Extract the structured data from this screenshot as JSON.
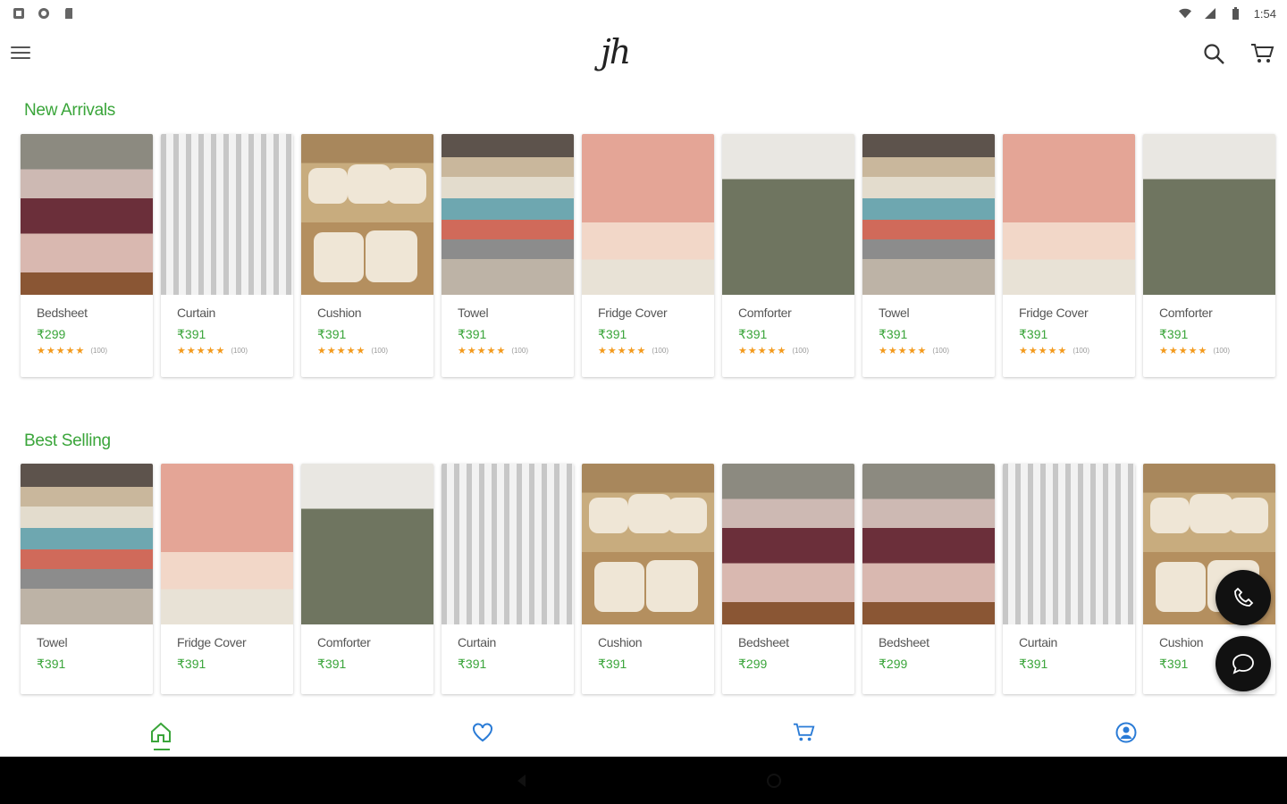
{
  "status_bar": {
    "time": "1:54",
    "left_icons": [
      "notification-icon",
      "sync-icon",
      "sd-card-icon"
    ],
    "right_icons": [
      "wifi-icon",
      "signal-icon",
      "battery-icon"
    ]
  },
  "app_bar": {
    "logo_text": "jh",
    "icons": [
      "menu-icon",
      "search-icon",
      "cart-icon"
    ]
  },
  "colors": {
    "accent": "#3aa53a",
    "price": "#3aa53a",
    "star": "#f39a1d",
    "fab": "#111111"
  },
  "new_arrivals": {
    "title": "New Arrivals",
    "items": [
      {
        "name": "Bedsheet",
        "price": "₹299",
        "stars": "★★★★★",
        "count": "(100)",
        "art": "bedsheet"
      },
      {
        "name": "Curtain",
        "price": "₹391",
        "stars": "★★★★★",
        "count": "(100)",
        "art": "curtain"
      },
      {
        "name": "Cushion",
        "price": "₹391",
        "stars": "★★★★★",
        "count": "(100)",
        "art": "cushion"
      },
      {
        "name": "Towel",
        "price": "₹391",
        "stars": "★★★★★",
        "count": "(100)",
        "art": "towel"
      },
      {
        "name": "Fridge Cover",
        "price": "₹391",
        "stars": "★★★★★",
        "count": "(100)",
        "art": "fridge"
      },
      {
        "name": "Comforter",
        "price": "₹391",
        "stars": "★★★★★",
        "count": "(100)",
        "art": "comforter"
      },
      {
        "name": "Towel",
        "price": "₹391",
        "stars": "★★★★★",
        "count": "(100)",
        "art": "towel"
      },
      {
        "name": "Fridge Cover",
        "price": "₹391",
        "stars": "★★★★★",
        "count": "(100)",
        "art": "fridge"
      },
      {
        "name": "Comforter",
        "price": "₹391",
        "stars": "★★★★★",
        "count": "(100)",
        "art": "comforter"
      }
    ]
  },
  "best_selling": {
    "title": "Best Selling",
    "items": [
      {
        "name": "Towel",
        "price": "₹391",
        "art": "towel"
      },
      {
        "name": "Fridge Cover",
        "price": "₹391",
        "art": "fridge"
      },
      {
        "name": "Comforter",
        "price": "₹391",
        "art": "comforter"
      },
      {
        "name": "Curtain",
        "price": "₹391",
        "art": "curtain"
      },
      {
        "name": "Cushion",
        "price": "₹391",
        "art": "cushion"
      },
      {
        "name": "Bedsheet",
        "price": "₹299",
        "art": "bedsheet"
      },
      {
        "name": "Bedsheet",
        "price": "₹299",
        "art": "bedsheet"
      },
      {
        "name": "Curtain",
        "price": "₹391",
        "art": "curtain"
      },
      {
        "name": "Cushion",
        "price": "₹391",
        "art": "cushion"
      }
    ]
  },
  "floating_buttons": [
    "phone-icon",
    "chat-icon"
  ],
  "bottom_nav": {
    "items": [
      {
        "icon": "home-icon",
        "active": true
      },
      {
        "icon": "heart-icon",
        "active": false
      },
      {
        "icon": "cart-icon",
        "active": false
      },
      {
        "icon": "account-icon",
        "active": false
      }
    ]
  },
  "system_nav": [
    "back-icon",
    "home-button-icon",
    "recents-icon"
  ]
}
